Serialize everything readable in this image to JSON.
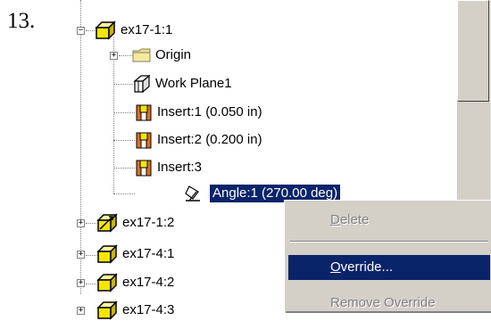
{
  "step_number": "13.",
  "tree": {
    "items": [
      {
        "label": "ex17-1:1",
        "expander": "−"
      },
      {
        "label": "Origin",
        "expander": "+"
      },
      {
        "label": "Work Plane1"
      },
      {
        "label": "Insert:1 (0.050 in)"
      },
      {
        "label": "Insert:2 (0.200 in)"
      },
      {
        "label": "Insert:3"
      },
      {
        "label": "Angle:1 (270.00 deg)"
      },
      {
        "label": "ex17-1:2",
        "expander": "+"
      },
      {
        "label": "ex17-4:1",
        "expander": "+"
      },
      {
        "label": "ex17-4:2",
        "expander": "+"
      },
      {
        "label": "ex17-4:3",
        "expander": "+"
      }
    ]
  },
  "context_menu": {
    "items": [
      {
        "label": "Delete",
        "mnemonic": "D",
        "rest": "elete",
        "state": "disabled"
      },
      {
        "label": "Override...",
        "mnemonic": "O",
        "rest": "verride...",
        "state": "active"
      },
      {
        "label": "Remove Override",
        "state": "disabled"
      }
    ]
  },
  "colors": {
    "selection": "#0a246a",
    "part_icon": "#f5e600",
    "folder_icon": "#f0e08a",
    "insert_icon": "#e07020"
  }
}
